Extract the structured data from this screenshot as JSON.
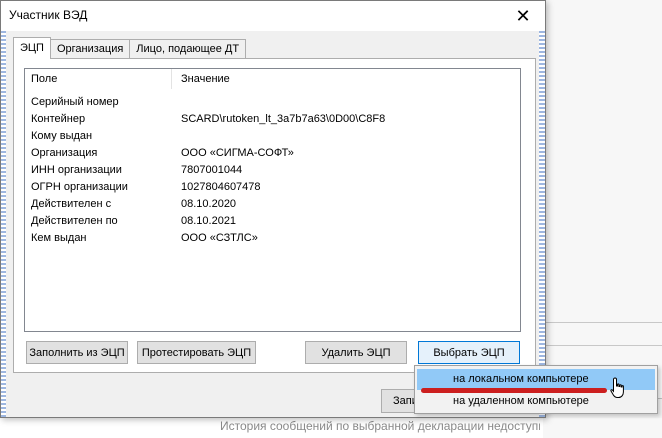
{
  "dialog": {
    "title": "Участник ВЭД",
    "close_glyph": "✕"
  },
  "tabs": [
    {
      "label": "ЭЦП",
      "active": true
    },
    {
      "label": "Организация",
      "active": false
    },
    {
      "label": "Лицо, подающее ДТ",
      "active": false
    }
  ],
  "list": {
    "headers": {
      "field": "Поле",
      "value": "Значение"
    },
    "rows": [
      {
        "field": "Серийный номер",
        "value": ""
      },
      {
        "field": "Контейнер",
        "value": "SCARD\\rutoken_lt_3a7b7a63\\0D00\\C8F8"
      },
      {
        "field": "Кому выдан",
        "value": ""
      },
      {
        "field": "Организация",
        "value": "ООО «СИГМА-СОФТ»"
      },
      {
        "field": "ИНН организации",
        "value": "7807001044"
      },
      {
        "field": "ОГРН организации",
        "value": "1027804607478"
      },
      {
        "field": "Действителен с",
        "value": "08.10.2020"
      },
      {
        "field": "Действителен по",
        "value": "08.10.2021"
      },
      {
        "field": "Кем выдан",
        "value": "ООО «СЗТЛС»"
      }
    ]
  },
  "buttons": {
    "fill_from_eds": "Заполнить из ЭЦП",
    "test_eds": "Протестировать ЭЦП",
    "delete_eds": "Удалить ЭЦП",
    "choose_eds": "Выбрать ЭЦП",
    "bottom_partial": "Запи"
  },
  "menu": {
    "items": [
      {
        "label": "на локальном компьютере",
        "hovered": true
      },
      {
        "label": "на удаленном компьютере",
        "hovered": false
      }
    ]
  },
  "background": {
    "footer_text": "История сообщений по выбранной декларации недоступна"
  },
  "colors": {
    "menu_hover": "#91c9f7",
    "annotation_underline": "#cc1f1f",
    "focus_border": "#0078d7"
  }
}
